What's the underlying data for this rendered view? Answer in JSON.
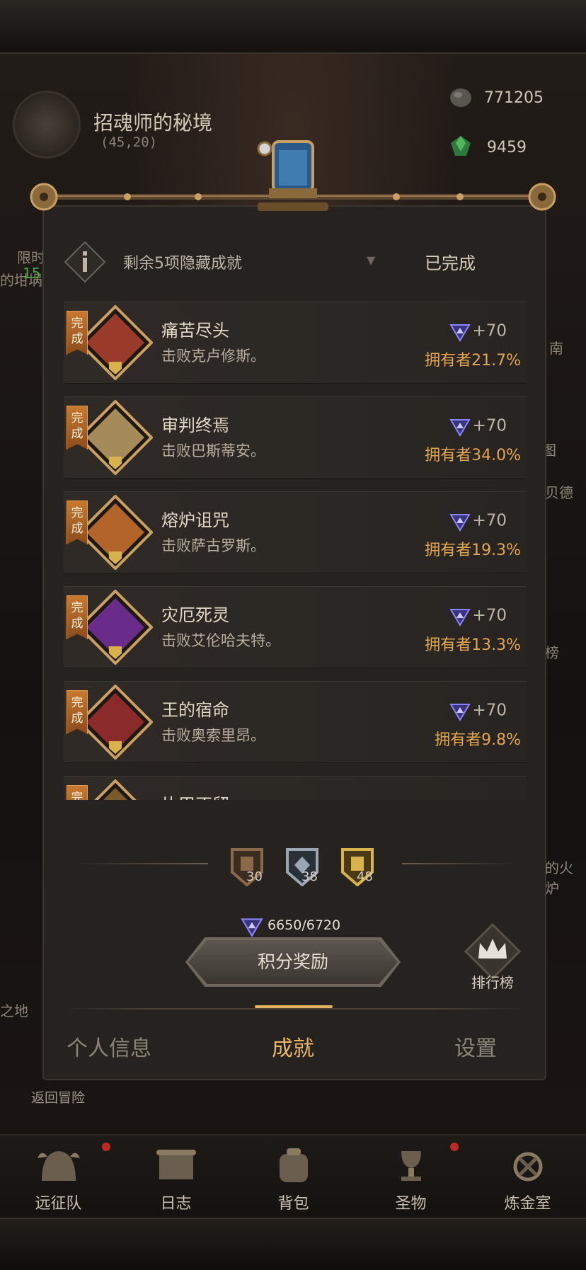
{
  "background": {
    "location_title": "招魂师的秘境",
    "coords": "(45,20)",
    "resources": [
      {
        "icon": "stone-icon",
        "value": "771205"
      },
      {
        "icon": "green-crystal-icon",
        "value": "9459"
      }
    ],
    "side_texts": {
      "left_limit": "限时",
      "left_partial": "的坩埚",
      "left_num": "15",
      "right_south": "南",
      "right_map": "图",
      "right_bede": "贝德",
      "right_list": "榜",
      "right_fire": "的火炉",
      "left_land": "之地"
    }
  },
  "panel": {
    "hidden_label": "剩余5项隐藏成就",
    "filter_label": "已完成",
    "achievements": [
      {
        "badge": "完成",
        "title": "痛苦尽头",
        "desc": "击败克卢修斯。",
        "reward": "+70",
        "owners": "拥有者21.7%",
        "color": "#9a3a2a"
      },
      {
        "badge": "完成",
        "title": "审判终焉",
        "desc": "击败巴斯蒂安。",
        "reward": "+70",
        "owners": "拥有者34.0%",
        "color": "#a58a5a"
      },
      {
        "badge": "完成",
        "title": "熔炉诅咒",
        "desc": "击败萨古罗斯。",
        "reward": "+70",
        "owners": "拥有者19.3%",
        "color": "#b2642a"
      },
      {
        "badge": "完成",
        "title": "灾厄死灵",
        "desc": "击败艾伦哈夫特。",
        "reward": "+70",
        "owners": "拥有者13.3%",
        "color": "#6a2c8a"
      },
      {
        "badge": "完成",
        "title": "王的宿命",
        "desc": "击败奥索里昂。",
        "reward": "+70",
        "owners": "拥有者9.8%",
        "color": "#8a2a2a"
      },
      {
        "badge": "完成",
        "title": "片甲不留",
        "desc": "",
        "reward": "",
        "owners": "",
        "color": "#7a5a2a"
      }
    ],
    "medals": [
      {
        "icon": "bronze-medal-icon",
        "count": "30",
        "color": "#8a6a48"
      },
      {
        "icon": "silver-medal-icon",
        "count": "38",
        "color": "#9aa6b4"
      },
      {
        "icon": "gold-medal-icon",
        "count": "48",
        "color": "#d8b24a"
      }
    ],
    "points": "6650/6720",
    "reward_button": "积分奖励",
    "rank_label": "排行榜",
    "tabs": [
      {
        "label": "个人信息",
        "active": false
      },
      {
        "label": "成就",
        "active": true
      },
      {
        "label": "设置",
        "active": false
      }
    ]
  },
  "back_adventure": "返回冒险",
  "nav": [
    {
      "label": "远征队",
      "icon": "helmet-icon",
      "dot": true
    },
    {
      "label": "日志",
      "icon": "scroll-icon",
      "dot": false
    },
    {
      "label": "背包",
      "icon": "backpack-icon",
      "dot": false
    },
    {
      "label": "圣物",
      "icon": "chalice-icon",
      "dot": true
    },
    {
      "label": "炼金室",
      "icon": "alchemy-icon",
      "dot": false
    }
  ],
  "colors": {
    "accent": "#e8b565",
    "owners": "#e2a64d",
    "badge": "#c9792f",
    "gem": "#6c5ad8"
  }
}
